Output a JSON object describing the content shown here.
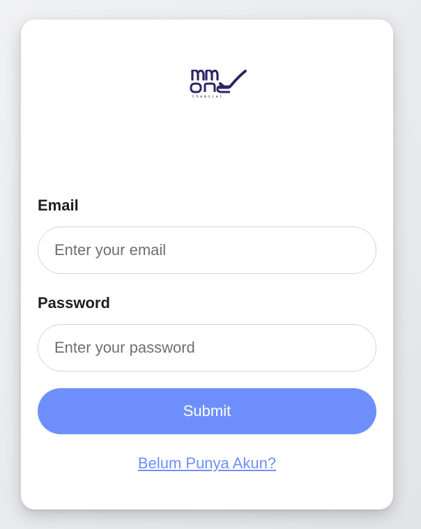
{
  "logo": {
    "brand": "One",
    "tagline": "Chemical"
  },
  "form": {
    "email": {
      "label": "Email",
      "placeholder": "Enter your email",
      "value": ""
    },
    "password": {
      "label": "Password",
      "placeholder": "Enter your password",
      "value": ""
    },
    "submit_label": "Submit",
    "register_link": "Belum Punya Akun?"
  },
  "colors": {
    "accent": "#6e8ffb",
    "logo": "#2d2466"
  }
}
